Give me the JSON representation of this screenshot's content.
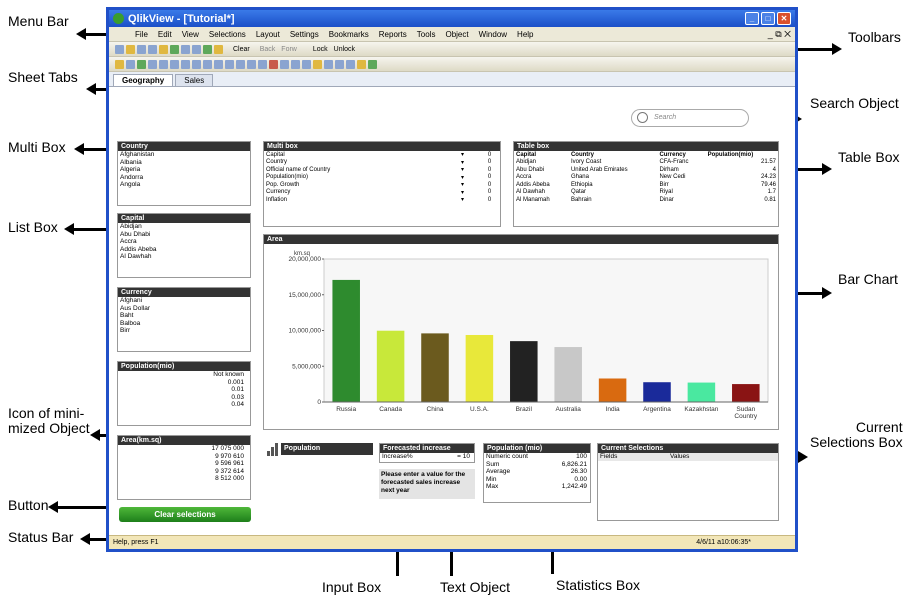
{
  "labels": {
    "menu_bar": "Menu Bar",
    "sheet_tabs": "Sheet Tabs",
    "multi_box": "Multi Box",
    "list_box": "List Box",
    "minimized": "Icon of mini-\nmized Object",
    "button": "Button",
    "status_bar": "Status Bar",
    "toolbars": "Toolbars",
    "search_object": "Search Object",
    "table_box": "Table Box",
    "bar_chart": "Bar Chart",
    "current_selections": "Current\nSelections Box",
    "input_box": "Input Box",
    "text_object": "Text Object",
    "statistics_box": "Statistics Box"
  },
  "window": {
    "title": "QlikView - [Tutorial*]"
  },
  "menu": [
    "File",
    "Edit",
    "View",
    "Selections",
    "Layout",
    "Settings",
    "Bookmarks",
    "Reports",
    "Tools",
    "Object",
    "Window",
    "Help"
  ],
  "mdi_controls": "_ ⧉ ✕",
  "toolbar": {
    "clear": "Clear",
    "back": "Back",
    "forward": "Forw",
    "lock": "Lock",
    "unlock": "Unlock"
  },
  "tabs": [
    "Geography",
    "Sales"
  ],
  "search": {
    "placeholder": "Search"
  },
  "country_list": {
    "title": "Country",
    "items": [
      "Afghanistan",
      "Albania",
      "Algeria",
      "Andorra",
      "Angola"
    ]
  },
  "capital_list": {
    "title": "Capital",
    "items": [
      "Abidjan",
      "Abu Dhabi",
      "Accra",
      "Addis Abeba",
      "Al Dawhah"
    ]
  },
  "currency_list": {
    "title": "Currency",
    "items": [
      "Afghani",
      "Aus Dollar",
      "Baht",
      "Balboa",
      "Birr"
    ]
  },
  "population_list": {
    "title": "Population(mio)",
    "items": [
      "Not known",
      "0.001",
      "0.01",
      "0.03",
      "0.04"
    ]
  },
  "area_list": {
    "title": "Area(km.sq)",
    "items": [
      "17 075 000",
      "9 970 610",
      "9 596 961",
      "9 372 614",
      "8 512 000"
    ]
  },
  "multibox": {
    "title": "Multi box",
    "rows": [
      {
        "field": "Capital",
        "value": "0"
      },
      {
        "field": "Country",
        "value": "0"
      },
      {
        "field": "Official name of Country",
        "value": "0"
      },
      {
        "field": "Population(mio)",
        "value": "0"
      },
      {
        "field": "Pop. Growth",
        "value": "0"
      },
      {
        "field": "Currency",
        "value": "0"
      },
      {
        "field": "Inflation",
        "value": "0"
      }
    ]
  },
  "tablebox": {
    "title": "Table box",
    "columns": [
      "Capital",
      "Country",
      "Currency",
      "Population(mio)"
    ],
    "rows": [
      [
        "Abidjan",
        "Ivory Coast",
        "CFA-Franc",
        "21.57"
      ],
      [
        "Abu Dhabi",
        "United Arab Emirates",
        "Dirham",
        "4"
      ],
      [
        "Accra",
        "Ghana",
        "New Cedi",
        "24.23"
      ],
      [
        "Addis Abeba",
        "Ethiopia",
        "Birr",
        "79.46"
      ],
      [
        "Al Dawhah",
        "Qatar",
        "Riyal",
        "1.7"
      ],
      [
        "Al Manamah",
        "Bahrain",
        "Dinar",
        "0.81"
      ]
    ]
  },
  "chart_data": {
    "type": "bar",
    "title": "Area",
    "ylabel": "km.sq",
    "categories": [
      "Russia",
      "Canada",
      "China",
      "U.S.A.",
      "Brazil",
      "Australia",
      "India",
      "Argentina",
      "Kazakhstan",
      "Sudan Country"
    ],
    "values": [
      17075000,
      9970610,
      9596961,
      9372614,
      8512000,
      7686850,
      3287590,
      2766890,
      2717300,
      2505810
    ],
    "colors": [
      "#2e8b2e",
      "#c8e83a",
      "#6b5a1e",
      "#e8e83a",
      "#222222",
      "#c8c8c8",
      "#d96a10",
      "#1a2a9a",
      "#4ae8a0",
      "#8a1414"
    ],
    "ylim": [
      0,
      20000000
    ],
    "yticks": [
      "0",
      "5,000,000",
      "10,000,000",
      "15,000,000",
      "20,000,000"
    ]
  },
  "minimized": {
    "label": "Population"
  },
  "inputbox": {
    "title": "Forecasted increase",
    "field": "Increase%",
    "value": "= 10"
  },
  "textobject": {
    "text": "Please enter a value for the forecasted sales increase next year"
  },
  "statsbox": {
    "title": "Population (mio)",
    "rows": [
      {
        "k": "Numeric count",
        "v": "100"
      },
      {
        "k": "Sum",
        "v": "6,826.21"
      },
      {
        "k": "Average",
        "v": "26.30"
      },
      {
        "k": "Min",
        "v": "0.00"
      },
      {
        "k": "Max",
        "v": "1,242.49"
      }
    ]
  },
  "currentselections": {
    "title": "Current Selections",
    "col1": "Fields",
    "col2": "Values"
  },
  "button": {
    "label": "Clear selections"
  },
  "status": {
    "left": "Help, press F1",
    "right": "4/6/11 a10:06:35*"
  }
}
